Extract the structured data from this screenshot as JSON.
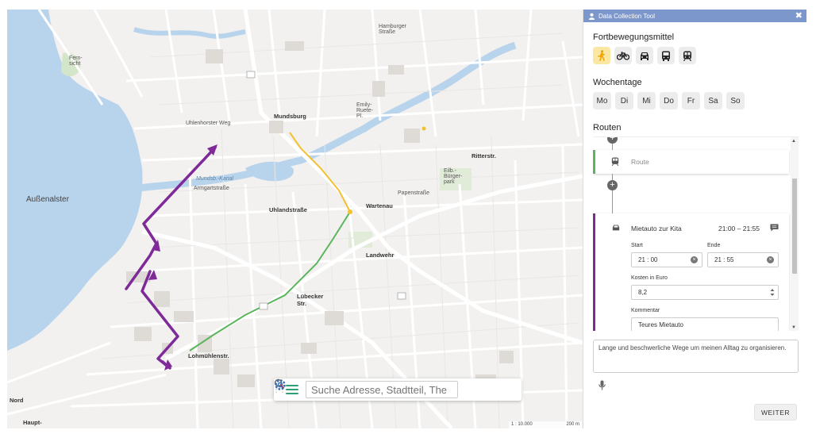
{
  "map": {
    "labels": {
      "aussenalster": "Außenalster",
      "mundsburg": "Mundsburg",
      "uhlandstrasse": "Uhlandstraße",
      "wartenau": "Wartenau",
      "landwehr": "Landwehr",
      "luebecker_str": "Lübecker Str.",
      "lohmuehlenstr": "Lohmühlenstr.",
      "hamburger_strasse": "Hamburger Straße",
      "uhlenhorster_weg": "Uhlenhorster Weg",
      "mundsburger_kanal": "Mundsb.-Kanal",
      "armgartstrasse": "Armgartstraße",
      "papenstrasse": "Papenstraße",
      "ritterstr": "Ritterstr.",
      "eilbeck": "Eilb.-Bürger-park",
      "fernsicht": "Fern-sicht",
      "emily_ruete": "Emily-Ruete-Pl.",
      "nord": "Nord",
      "haupt": "Haupt-"
    },
    "search": {
      "placeholder": "Suche Adresse, Stadtteil, The"
    },
    "scale": {
      "ratio": "1 : 10.000",
      "distance": "200 m"
    },
    "route_colors": {
      "walk": "#f2c12e",
      "car_green": "#5bb55b",
      "car_purple": "#7e2a98"
    }
  },
  "panel": {
    "title": "Data Collection Tool",
    "close": "✖",
    "transport": {
      "heading": "Fortbewegungsmittel",
      "modes": [
        "walk-icon",
        "bicycle-icon",
        "car-icon",
        "bus-icon",
        "train-icon"
      ],
      "active_mode": "walk"
    },
    "weekdays": {
      "heading": "Wochentage",
      "days": [
        "Mo",
        "Di",
        "Mi",
        "Do",
        "Fr",
        "Sa",
        "So"
      ]
    },
    "routes": {
      "heading": "Routen",
      "plus": "+",
      "route_placeholder": {
        "icon": "train-icon",
        "label": "Route"
      },
      "active_route": {
        "icon": "car-icon",
        "name": "Mietauto zur Kita",
        "time": "21:00 – 21:55",
        "start_label": "Start",
        "start_value": "21 : 00",
        "end_label": "Ende",
        "end_value": "21 : 55",
        "cost_label": "Kosten in Euro",
        "cost_value": "8,2",
        "comment_label": "Kommentar",
        "comment_value": "Teures Mietauto"
      }
    },
    "summary": "Lange und beschwerliche Wege um meinen Alltag zu organisieren.",
    "next_button": "WEITER"
  }
}
